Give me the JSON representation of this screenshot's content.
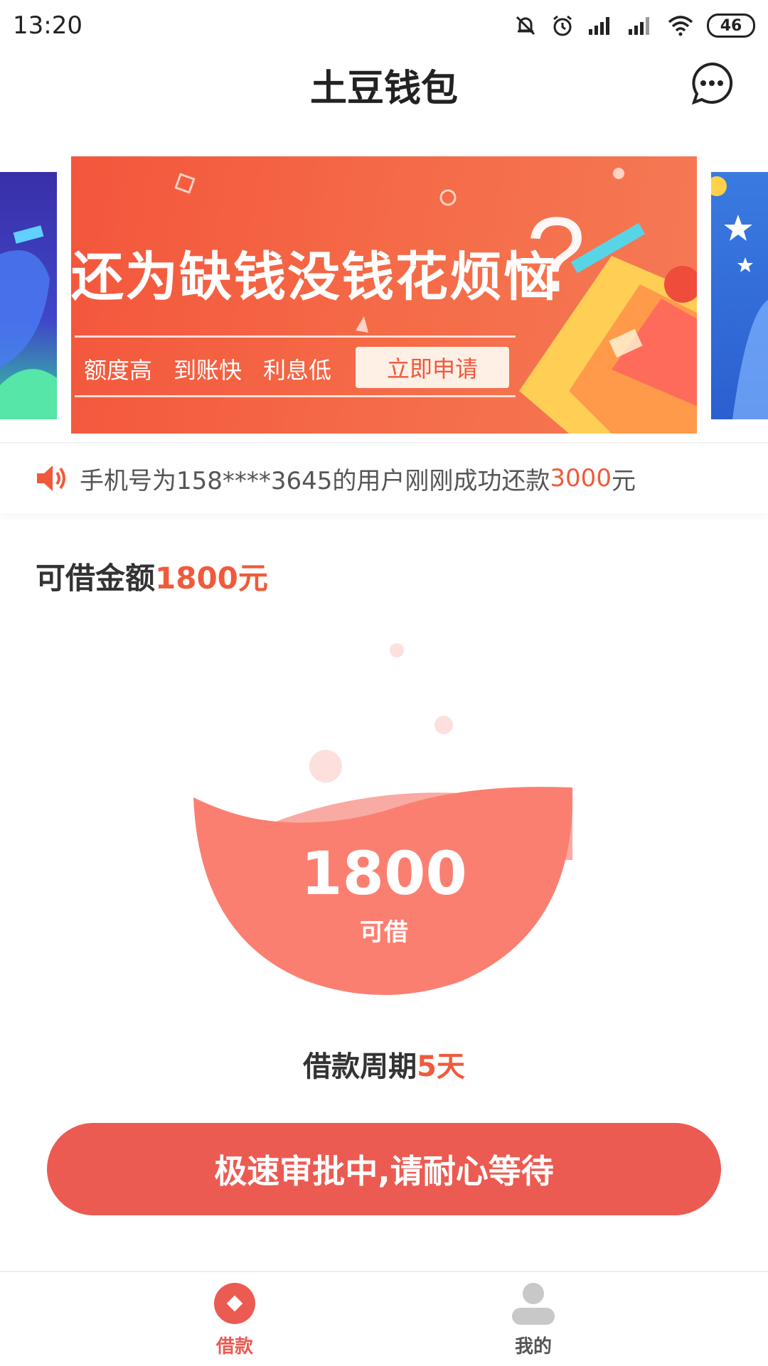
{
  "status_bar": {
    "time": "13:20",
    "battery": "46"
  },
  "header": {
    "title": "土豆钱包"
  },
  "banner": {
    "headline": "还为缺钱没钱花烦恼",
    "features": [
      "额度高",
      "到账快",
      "利息低"
    ],
    "apply_label": "立即申请"
  },
  "notice": {
    "prefix": "手机号为158****3645的用户刚刚成功还款",
    "amount": "3000",
    "suffix": "元"
  },
  "borrow": {
    "label": "可借金额",
    "value": "1800元"
  },
  "bowl": {
    "amount": "1800",
    "caption": "可借"
  },
  "period": {
    "label": "借款周期",
    "value": "5天"
  },
  "cta": {
    "label": "极速审批中,请耐心等待"
  },
  "tabs": [
    {
      "label": "借款",
      "active": true
    },
    {
      "label": "我的",
      "active": false
    }
  ],
  "colors": {
    "accent": "#f05a3b",
    "button": "#eb5b52",
    "banner": "#f3563c",
    "inactive_tab": "#c8c8c8"
  }
}
